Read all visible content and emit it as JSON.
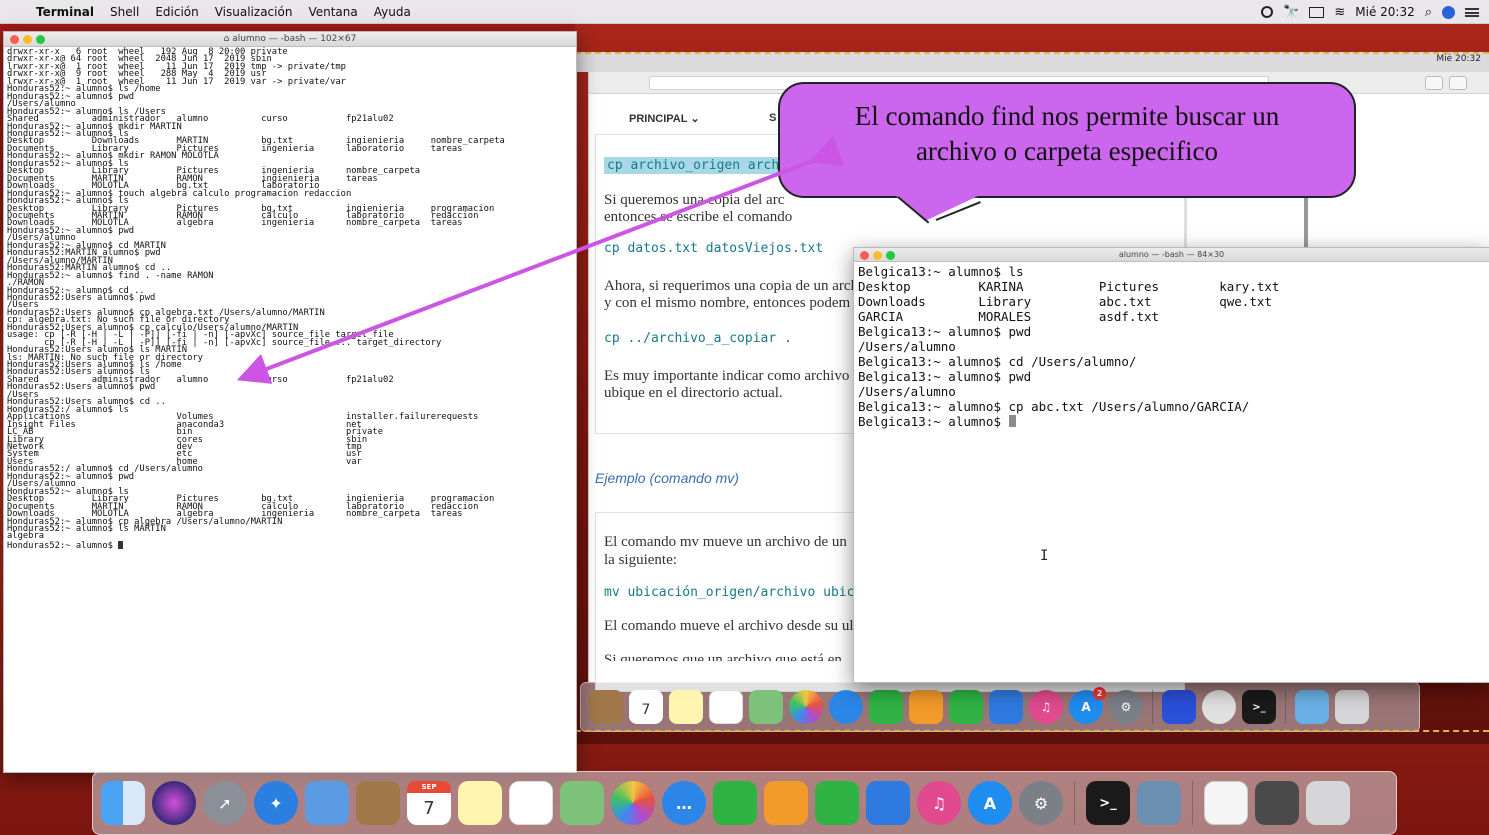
{
  "menubar": {
    "app_name": "Terminal",
    "menus": [
      "Shell",
      "Edición",
      "Visualización",
      "Ventana",
      "Ayuda"
    ],
    "clock": "Mié 20:32",
    "icons": [
      "stopwatch-icon",
      "binoculars-icon",
      "screen-mirror-icon",
      "wifi-icon",
      "search-icon",
      "siri-icon",
      "notification-center-icon"
    ]
  },
  "remote": {
    "menubar_clock": "Mié 20:32",
    "nav_principal": "PRINCIPAL ⌄",
    "nav_second": "S",
    "article": {
      "code1": "cp archivo_origen archi",
      "prose1a": "Si queremos una copia del arc",
      "prose1b": "entonces se escribe el comando",
      "code2": "cp datos.txt datosViejos.txt",
      "prose2a": "Ahora, si requerimos una copia de un arch",
      "prose2b": "y con el mismo nombre, entonces podem",
      "code3": "cp   ../archivo_a_copiar   .",
      "prose3a": "Es muy importante indicar como archivo",
      "prose3b": "ubique en el directorio actual."
    },
    "example_heading": "Ejemplo (comando mv)",
    "article2": {
      "prose1a": "El comando mv mueve un archivo de un",
      "prose1b": "la siguiente:",
      "code1": "mv ubicación_origen/archivo ubica",
      "prose2": "El comando mueve el archivo desde su ul",
      "prose3": "Si queremos que un archivo que está en"
    }
  },
  "callout": {
    "line1": "El comando find nos permite buscar un",
    "line2": "archivo o carpeta especifico"
  },
  "term_left": {
    "title": "alumno — -bash — 102×67",
    "lines": [
      "drwxr-xr-x   6 root  wheel   192 Aug  8 20:00 private",
      "drwxr-xr-x@ 64 root  wheel  2048 Jun 17  2019 sbin",
      "lrwxr-xr-x@  1 root  wheel    11 Jun 17  2019 tmp -> private/tmp",
      "drwxr-xr-x@  9 root  wheel   288 May  4  2019 usr",
      "lrwxr-xr-x@  1 root  wheel    11 Jun 17  2019 var -> private/var",
      "Honduras52:~ alumno$ ls /home",
      "Honduras52:~ alumno$ pwd",
      "/Users/alumno",
      "Honduras52:~ alumno$ ls /Users",
      "Shared          administrador   alumno          curso           fp21alu02",
      "Honduras52:~ alumno$ mkdir MARTIN",
      "Honduras52:~ alumno$ ls",
      "Desktop         Downloads       MARTIN          bg.txt          ingienieria     nombre_carpeta",
      "Documents       Library         Pictures        ingenieria      laboratorio     tareas",
      "Honduras52:~ alumno$ mkdir RAMON MOLOTLA",
      "Honduras52:~ alumno$ ls",
      "Desktop         Library         Pictures        ingenieria      nombre_carpeta",
      "Documents       MARTIN          RAMON           ingienieria     tareas",
      "Downloads       MOLOTLA         bg.txt          laboratorio",
      "Honduras52:~ alumno$ touch algebra calculo programacion redaccion",
      "Honduras52:~ alumno$ ls",
      "Desktop         Library         Pictures        bg.txt          ingienieria     programacion",
      "Documents       MARTIN          RAMON           calculo         laboratorio     redaccion",
      "Downloads       MOLOTLA         algebra         ingenieria      nombre_carpeta  tareas",
      "Honduras52:~ alumno$ pwd",
      "/Users/alumno",
      "Honduras52:~ alumno$ cd MARTIN",
      "Honduras52:MARTIN alumno$ pwd",
      "/Users/alumno/MARTIN",
      "Honduras52:MARTIN alumno$ cd ..",
      "Honduras52:~ alumno$ find . -name RAMON",
      "./RAMON",
      "Honduras52:~ alumno$ cd ..",
      "Honduras52:Users alumno$ pwd",
      "/Users",
      "Honduras52:Users alumno$ cp algebra.txt /Users/alumno/MARTIN",
      "cp: algebra.txt: No such file or directory",
      "Honduras52:Users alumno$ cp calculo/Users/alumno/MARTIN",
      "usage: cp [-R [-H | -L | -P]] [-fi | -n] [-apvXc] source_file target_file",
      "       cp [-R [-H | -L | -P]] [-fi | -n] [-apvXc] source_file ... target_directory",
      "Honduras52:Users alumno$ ls MARTIN",
      "ls: MARTIN: No such file or directory",
      "Honduras52:Users alumno$ ls /home",
      "Honduras52:Users alumno$ ls",
      "Shared          administrador   alumno          curso           fp21alu02",
      "Honduras52:Users alumno$ pwd",
      "/Users",
      "Honduras52:Users alumno$ cd ..",
      "Honduras52:/ alumno$ ls",
      "Applications                    Volumes                         installer.failurerequests",
      "Insight Files                   anaconda3                       net",
      "LC_AB                           bin                             private",
      "Library                         cores                           sbin",
      "Network                         dev                             tmp",
      "System                          etc                             usr",
      "Users                           home                            var",
      "Honduras52:/ alumno$ cd /Users/alumno",
      "Honduras52:~ alumno$ pwd",
      "/Users/alumno",
      "Honduras52:~ alumno$ ls",
      "Desktop         Library         Pictures        bg.txt          ingienieria     programacion",
      "Documents       MARTIN          RAMON           calculo         laboratorio     redaccion",
      "Downloads       MOLOTLA         algebra         ingenieria      nombre_carpeta  tareas",
      "Honduras52:~ alumno$ cp algebra /Users/alumno/MARTIN",
      "Honduras52:~ alumno$ ls MARTIN",
      "algebra",
      "Honduras52:~ alumno$ "
    ]
  },
  "term_right": {
    "title": "alumno — -bash — 84×30",
    "lines": [
      "Belgica13:~ alumno$ ls",
      "Desktop         KARINA          Pictures        kary.txt",
      "Downloads       Library         abc.txt         qwe.txt",
      "GARCIA          MORALES         asdf.txt",
      "Belgica13:~ alumno$ pwd",
      "/Users/alumno",
      "Belgica13:~ alumno$ cd /Users/alumno/",
      "Belgica13:~ alumno$ pwd",
      "/Users/alumno",
      "Belgica13:~ alumno$ cp abc.txt /Users/alumno/GARCIA/",
      "Belgica13:~ alumno$ "
    ]
  },
  "dock": {
    "calendar_month": "SEP",
    "calendar_day": "7",
    "remote_calendar_day": "7",
    "remote_appstore_badge": "2",
    "terminal_glyph": ">_",
    "colors": {
      "finder": "#3d8ee8",
      "siri": "#3a2a7a",
      "launchpad": "#8a8f98",
      "safari": "#2b7fe0",
      "mail": "#5a9be3",
      "contacts": "#a0784a",
      "calendar": "#ffffff",
      "notes": "#fff4b0",
      "reminders": "#ffffff",
      "maps": "#7dc27a",
      "photos": "#f0f0f0",
      "messages": "#3cc04a",
      "facetime": "#2fb344",
      "pages": "#f29a2a",
      "numbers": "#2fb344",
      "keynote": "#2e7ae0",
      "itunes": "#e14a8e",
      "appstore": "#1f8cf0",
      "prefs": "#7a7f88",
      "terminal": "#1a1a1a",
      "preview": "#6a8fb0",
      "textedit": "#f5f5f5",
      "finder-window": "#4a4a4a",
      "trash": "#d6d6d8"
    }
  }
}
